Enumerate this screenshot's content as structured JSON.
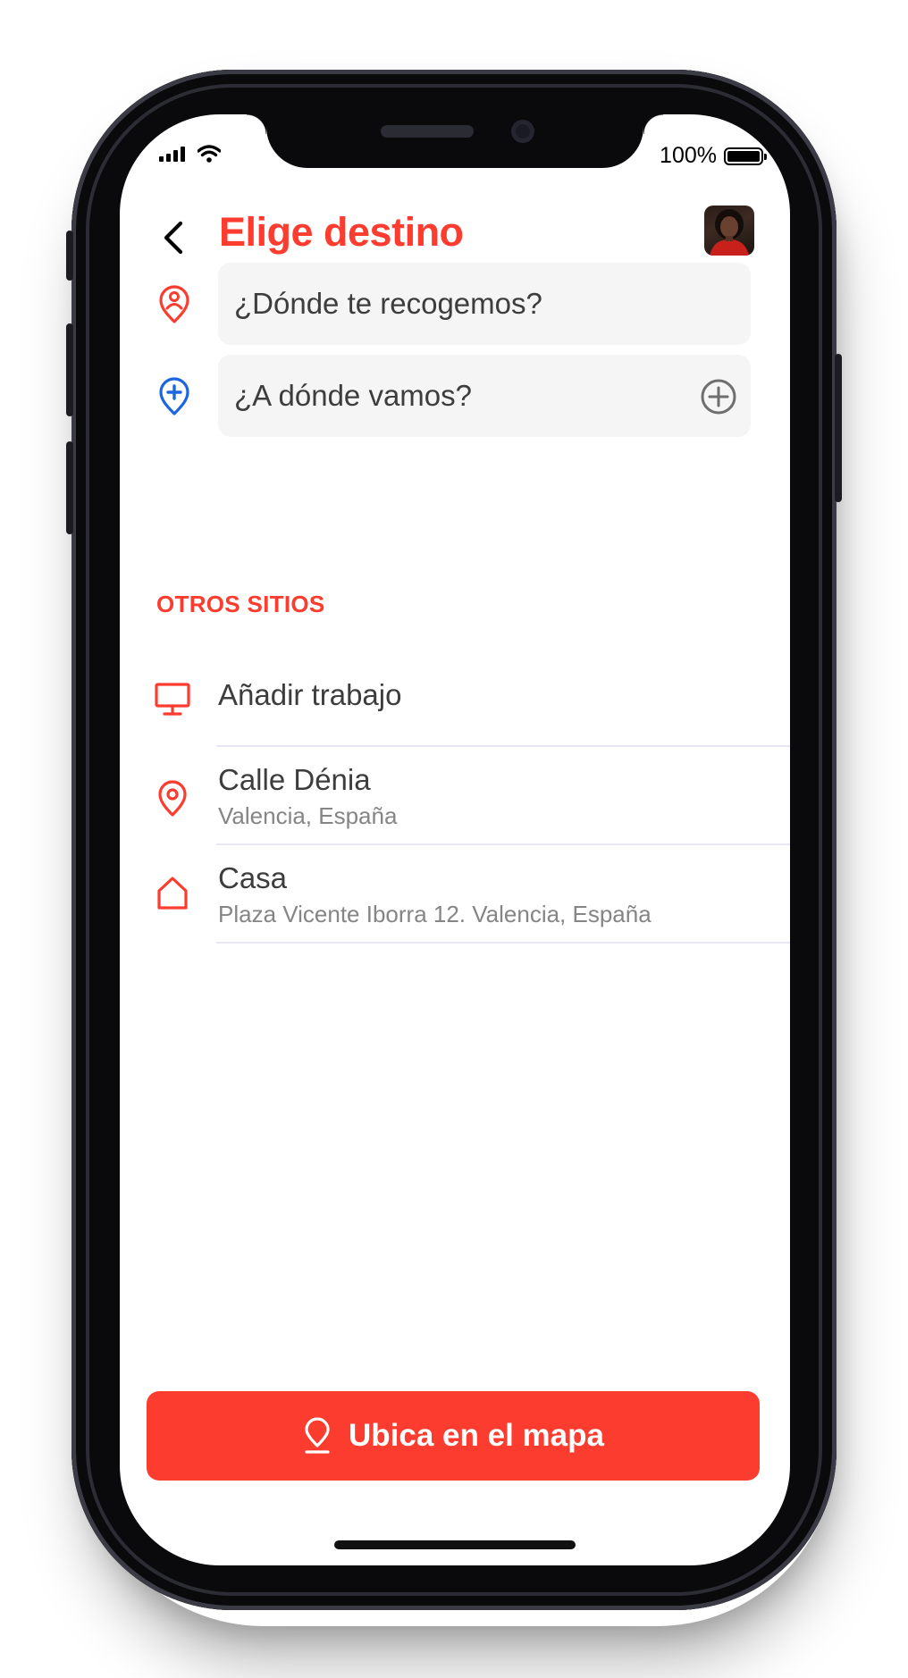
{
  "status_bar": {
    "battery_label": "100%"
  },
  "header": {
    "title": "Elige destino",
    "back_icon": "chevron-left-icon",
    "avatar_icon": "user-avatar"
  },
  "route": {
    "pickup": {
      "placeholder": "¿Dónde te recogemos?",
      "icon": "pin-person-icon",
      "color": "#fc3c2f"
    },
    "destination": {
      "placeholder": "¿A dónde vamos?",
      "icon": "pin-plus-icon",
      "color": "#1a66e0",
      "action_icon": "add-circle-icon"
    }
  },
  "places": {
    "section_label": "OTROS SITIOS",
    "items": [
      {
        "title": "Añadir trabajo",
        "subtitle": "",
        "icon": "monitor-icon"
      },
      {
        "title": "Calle Dénia",
        "subtitle": "Valencia, España",
        "icon": "map-pin-icon"
      },
      {
        "title": "Casa",
        "subtitle": "Plaza Vicente Iborra 12. Valencia, España",
        "icon": "home-icon"
      }
    ]
  },
  "footer": {
    "map_button_label": "Ubica en el mapa",
    "map_button_icon": "location-pin-icon"
  },
  "colors": {
    "accent": "#fc3c2f",
    "blue": "#1a66e0",
    "field_bg": "#f5f5f5",
    "text": "#3d3d3d",
    "subtext": "#858585"
  }
}
